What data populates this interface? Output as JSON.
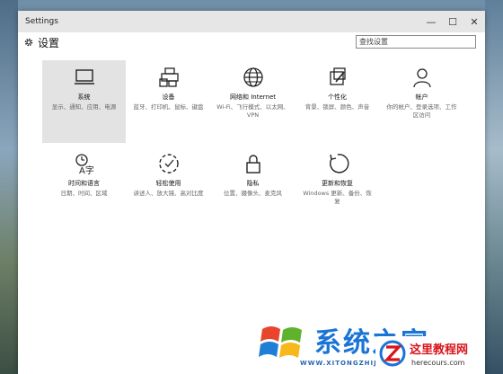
{
  "window": {
    "title": "Settings",
    "controls": {
      "minimize": "—",
      "maximize": "☐",
      "close": "✕"
    }
  },
  "header": {
    "title": "设置",
    "search_placeholder": "查找设置"
  },
  "tiles": [
    {
      "name": "系统",
      "desc": "显示、通知、应用、电源",
      "icon": "monitor-icon",
      "selected": true
    },
    {
      "name": "设备",
      "desc": "蓝牙、打印机、鼠标、键盘",
      "icon": "devices-icon"
    },
    {
      "name": "网络和 Internet",
      "desc": "Wi-Fi、飞行模式、以太网、VPN",
      "icon": "globe-icon"
    },
    {
      "name": "个性化",
      "desc": "背景、锁屏、颜色、声音",
      "icon": "personalization-icon"
    },
    {
      "name": "帐户",
      "desc": "你的帐户、登录选项、工作区访问",
      "icon": "person-icon"
    },
    {
      "name": "时间和语言",
      "desc": "日期、时间、区域",
      "icon": "time-language-icon"
    },
    {
      "name": "轻松使用",
      "desc": "讲述人、放大镜、高对比度",
      "icon": "ease-of-access-icon"
    },
    {
      "name": "隐私",
      "desc": "位置、摄像头、麦克风",
      "icon": "lock-icon"
    },
    {
      "name": "更新和恢复",
      "desc": "Windows 更新、备份、恢复",
      "icon": "update-icon"
    }
  ],
  "watermark": {
    "text": "系统之家",
    "url": "WWW.XITONGZHIJIA.NET",
    "badge_name": "这里教程网",
    "badge_url": "herecours.com"
  },
  "colors": {
    "accent": "#1a74d6",
    "badge_red": "#d9141b",
    "selected_tile": "#e3e3e3"
  }
}
